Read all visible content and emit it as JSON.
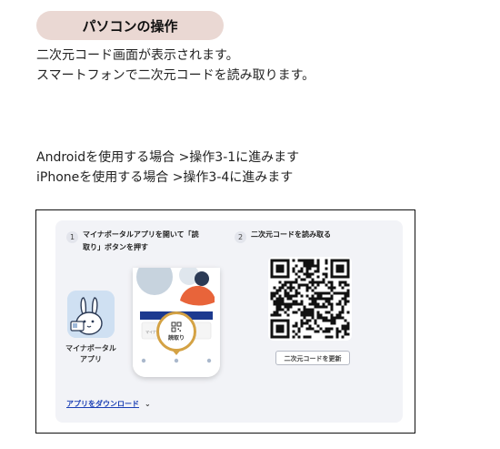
{
  "section_title": "パソコンの操作",
  "intro_lines": [
    "二次元コード画面が表示されます。",
    "スマートフォンで二次元コードを読み取ります。"
  ],
  "paths": [
    "Androidを使用する場合 >操作3-1に進みます",
    "iPhoneを使用する場合 >操作3-4に進みます"
  ],
  "screenshot": {
    "step1": {
      "number": "1",
      "lines": [
        "マイナポータルアプリを開いて「読",
        "取り」ボタンを押す"
      ]
    },
    "step2": {
      "number": "2",
      "label": "二次元コードを読み取る"
    },
    "app": {
      "name_lines": [
        "マイナポータル",
        "アプリ"
      ]
    },
    "phone": {
      "read_button_label": "読取り"
    },
    "refresh_button_label": "二次元コードを更新",
    "download_link_label": "アプリをダウンロード",
    "colors": {
      "panel_bg": "#f2f3f7",
      "link": "#1a3fb5",
      "accent_orange": "#e8643a",
      "accent_gold": "#d4a244",
      "pill_bg": "#ead8d3"
    }
  }
}
